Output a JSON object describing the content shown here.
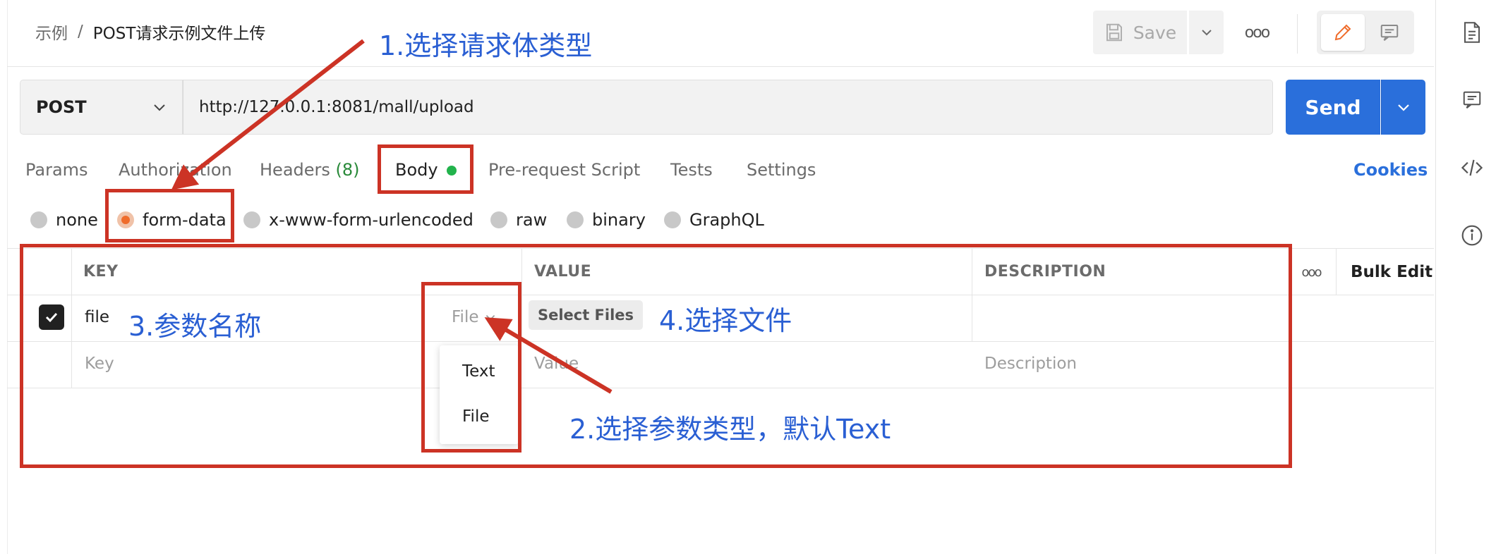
{
  "breadcrumb": {
    "parent": "示例",
    "separator": "/",
    "current": "POST请求示例文件上传"
  },
  "toolbar": {
    "save_label": "Save",
    "more": "ooo"
  },
  "request": {
    "method": "POST",
    "url": "http://127.0.0.1:8081/mall/upload",
    "send_label": "Send"
  },
  "tabs": [
    {
      "label": "Params"
    },
    {
      "label": "Authorization"
    },
    {
      "label": "Headers",
      "count": "(8)"
    },
    {
      "label": "Body"
    },
    {
      "label": "Pre-request Script"
    },
    {
      "label": "Tests"
    },
    {
      "label": "Settings"
    }
  ],
  "cookies_label": "Cookies",
  "body_types": [
    "none",
    "form-data",
    "x-www-form-urlencoded",
    "raw",
    "binary",
    "GraphQL"
  ],
  "selected_body_type": "form-data",
  "table": {
    "headers": {
      "key": "KEY",
      "value": "VALUE",
      "description": "DESCRIPTION"
    },
    "more": "ooo",
    "bulk_edit": "Bulk Edit",
    "rows": [
      {
        "checked": true,
        "key": "file",
        "type": "File",
        "value_button": "Select Files"
      }
    ],
    "placeholders": {
      "key": "Key",
      "value": "Value",
      "description": "Description"
    }
  },
  "type_dropdown": {
    "options": [
      "Text",
      "File"
    ]
  },
  "annotations": {
    "step1": "1.选择请求体类型",
    "step2": "2.选择参数类型，默认Text",
    "step3": "3.参数名称",
    "step4": "4.选择文件"
  },
  "colors": {
    "accent": "#2a6fdb",
    "annotation_red": "#cc3325",
    "annotation_blue": "#2a5fd3",
    "radio_selected": "#ef6c2b",
    "body_dot": "#22b34c"
  }
}
